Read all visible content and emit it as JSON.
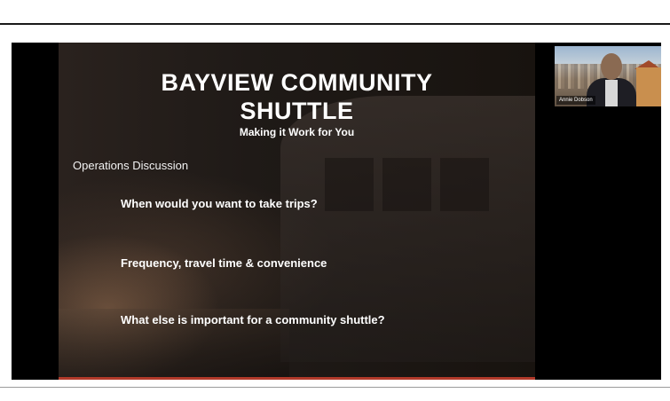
{
  "slide": {
    "title_line1": "BAYVIEW COMMUNITY",
    "title_line2": "SHUTTLE",
    "subtitle": "Making it Work for You",
    "section_heading": "Operations Discussion",
    "bullets": [
      "When would you want to take trips?",
      "Frequency, travel time & convenience",
      "What else is important for a community shuttle?"
    ]
  },
  "participant": {
    "name_tag": "Annie Dobson"
  },
  "colors": {
    "slide_accent": "#b23a2a",
    "slide_text": "#ffffff",
    "meeting_background": "#000000"
  }
}
